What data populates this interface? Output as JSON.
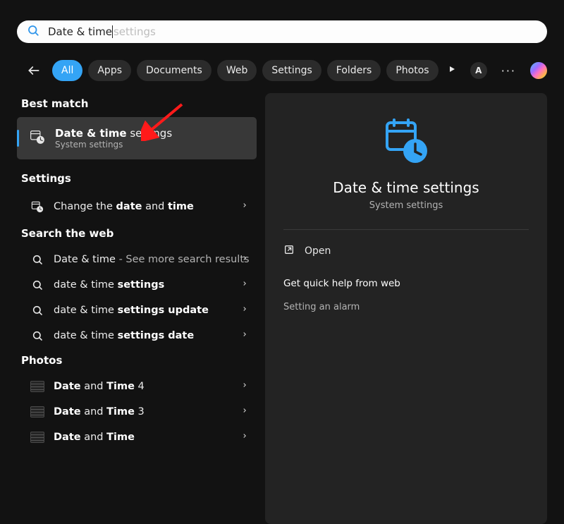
{
  "search": {
    "query": "Date & time",
    "ghost": " settings"
  },
  "filters": [
    "All",
    "Apps",
    "Documents",
    "Web",
    "Settings",
    "Folders",
    "Photos"
  ],
  "avatar_initial": "A",
  "left": {
    "best_match_label": "Best match",
    "best_match": {
      "title_prefix": "Date & time",
      "title_suffix": " settings",
      "subtitle": "System settings"
    },
    "settings_label": "Settings",
    "settings_items": [
      {
        "html": "Change the <b>date</b> and <b>time</b>"
      }
    ],
    "web_label": "Search the web",
    "web_items": [
      {
        "html": "Date & time <span class='dim'>- See more search results</span>"
      },
      {
        "html": "date & time <b>settings</b>"
      },
      {
        "html": "date & time <b>settings update</b>"
      },
      {
        "html": "date & time <b>settings date</b>"
      }
    ],
    "photos_label": "Photos",
    "photos_items": [
      {
        "html": "<b>Date</b> and <b>Time</b> 4"
      },
      {
        "html": "<b>Date</b> and <b>Time</b> 3"
      },
      {
        "html": "<b>Date</b> and <b>Time</b>"
      }
    ]
  },
  "panel": {
    "title": "Date & time settings",
    "subtitle": "System settings",
    "open": "Open",
    "help_header": "Get quick help from web",
    "help_link": "Setting an alarm"
  }
}
